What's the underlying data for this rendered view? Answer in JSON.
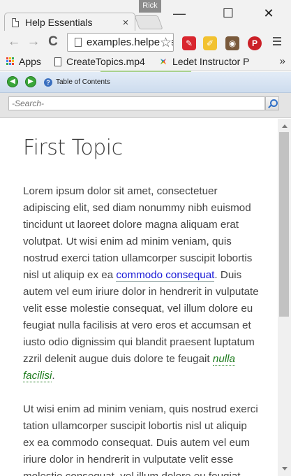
{
  "browser": {
    "profile_name": "Rick",
    "tab_title": "Help Essentials",
    "tab_close": "×",
    "window_controls": {
      "minimize": "—",
      "maximize": "☐",
      "close": "✕"
    },
    "nav": {
      "back": "←",
      "forward": "→",
      "reload": "C"
    },
    "address": "examples.helpessentials.com",
    "star": "☆",
    "extensions": [
      {
        "name": "adblock-icon",
        "color": "#d9262f",
        "glyph": "✎"
      },
      {
        "name": "notepad-icon",
        "color": "#f2c230",
        "glyph": "✐"
      },
      {
        "name": "instagram-icon",
        "color": "#7a5a3c",
        "glyph": "◉"
      },
      {
        "name": "pinterest-icon",
        "color": "#cb2027",
        "glyph": "P"
      }
    ],
    "bookmarks": {
      "apps": "Apps",
      "items": [
        "CreateTopics.mp4",
        "Ledet Instructor P"
      ],
      "overflow": "»"
    }
  },
  "help_viewer": {
    "back_icon": "◀",
    "forward_icon": "▶",
    "toc_icon": "?",
    "toc_label": "Table of Contents",
    "search": {
      "placeholder": "-Search-",
      "value": ""
    }
  },
  "topic": {
    "title": "First Topic",
    "p1": {
      "before_link": "Lorem ipsum dolor sit amet, consectetuer adipiscing elit, sed diam nonummy nibh euismod tincidunt ut laoreet dolore magna aliquam erat volutpat. Ut wisi enim ad minim veniam, quis nostrud exerci tation ullamcorper suscipit lobortis nisl ut aliquip ex ea ",
      "link": "commodo consequat",
      "after_link": ". Duis autem vel eum iriure dolor in hendrerit in vulputate velit esse molestie consequat, vel illum dolore eu feugiat nulla facilisis at vero eros et accumsan et iusto odio dignissim qui blandit praesent luptatum zzril delenit augue duis dolore te feugait ",
      "glossary": "nulla facilisi",
      "end": "."
    },
    "p2": "Ut wisi enim ad minim veniam, quis nostrud exerci tation ullamcorper suscipit lobortis nisl ut aliquip ex ea commodo consequat. Duis autem vel eum iriure dolor in hendrerit in vulputate velit esse molestie consequat, vel illum dolore eu feugiat"
  }
}
